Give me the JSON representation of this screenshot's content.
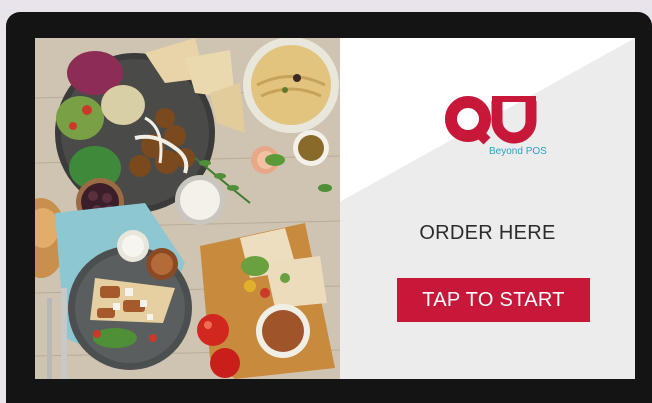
{
  "brand": {
    "logo_text": "QU",
    "tagline": "Beyond POS",
    "color": "#c8183a",
    "tagline_color": "#2aa0c8"
  },
  "kiosk": {
    "prompt": "ORDER HERE",
    "start_button_label": "TAP TO START",
    "button_color": "#c8183a"
  },
  "hero_image": {
    "icon": "food-photo"
  }
}
